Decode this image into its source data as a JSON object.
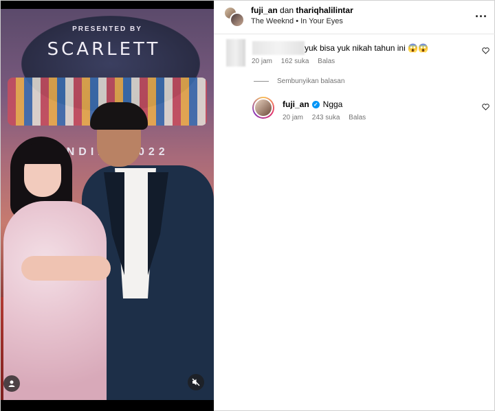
{
  "media": {
    "poster_brand": "PRESENTED BY",
    "poster_sponsor": "SCARLETT",
    "poster_year": "INDIES 2022"
  },
  "header": {
    "user1": "fuji_an",
    "connector": "dan",
    "user2": "thariqhalilintar",
    "audio": "The Weeknd • In Your Eyes",
    "more": "..."
  },
  "comment": {
    "text": "yuk bisa yuk nikah tahun ini 😱😱",
    "time": "20 jam",
    "likes": "162 suka",
    "reply": "Balas"
  },
  "hide_replies": "Sembunyikan balasan",
  "reply": {
    "username": "fuji_an",
    "text": "Ngga",
    "time": "20 jam",
    "likes": "243 suka",
    "reply": "Balas"
  },
  "icons": {
    "heart": "heart-icon",
    "verified": "verified-badge-icon",
    "mute": "mute-icon",
    "user_tag": "user-tag-icon",
    "more": "more-options-icon"
  }
}
